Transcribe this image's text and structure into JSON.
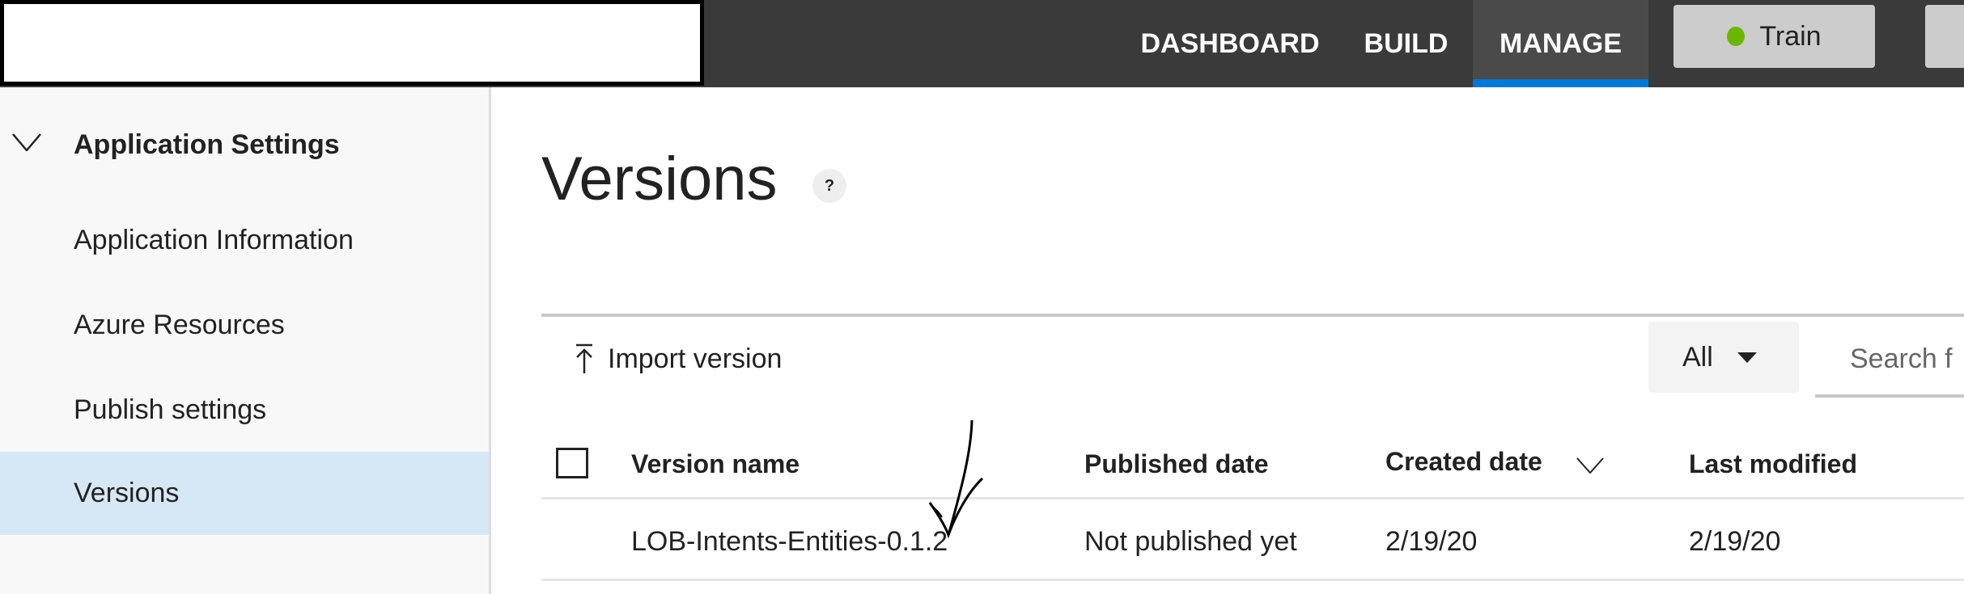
{
  "topbar": {
    "nav": [
      "DASHBOARD",
      "BUILD",
      "MANAGE"
    ],
    "active_nav": "MANAGE",
    "train_label": "Train",
    "train_status_color": "#6bb700",
    "accent": "#0078d4"
  },
  "sidebar": {
    "section": "Application Settings",
    "items": [
      "Application Information",
      "Azure Resources",
      "Publish settings",
      "Versions"
    ],
    "selected": "Versions"
  },
  "main": {
    "title": "Versions",
    "help": "?",
    "import_label": "Import version",
    "filter_value": "All",
    "search_placeholder": "Search f",
    "columns": [
      "Version name",
      "Published date",
      "Created date",
      "Last modified"
    ],
    "rows": [
      {
        "name": "LOB-Intents-Entities-0.1.2",
        "published": "Not published yet",
        "created": "2/19/20",
        "modified": "2/19/20"
      }
    ]
  }
}
